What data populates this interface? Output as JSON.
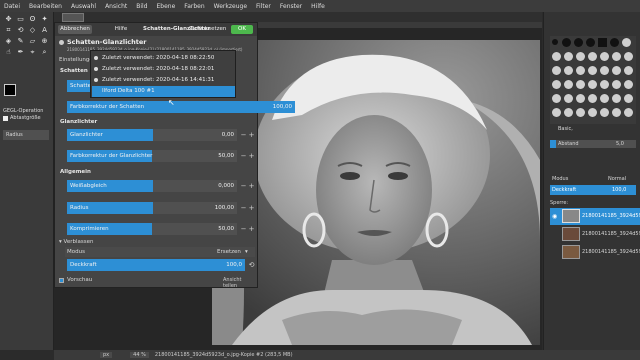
{
  "menubar": {
    "items": [
      "Datei",
      "Bearbeiten",
      "Auswahl",
      "Ansicht",
      "Bild",
      "Ebene",
      "Farben",
      "Werkzeuge",
      "Filter",
      "Fenster",
      "Hilfe"
    ]
  },
  "tool_options": {
    "title": "GEGL-Operation",
    "sample_merged": "Abtastgröße",
    "radius_label": "Radius"
  },
  "dialog": {
    "cancel": "Abbrechen",
    "help": "Hilfe",
    "title": "Schatten-Glanzlichter",
    "reset": "Zurücksetzen",
    "ok": "OK",
    "op_title": "Schatten-Glanzlichter",
    "image_ref": "21800141185_3924d5923d_o.jpg-Kopie-[2] (21800141185_3924d5923d_o) (importiert)",
    "presets_label": "Einstellungen",
    "section_shadows": "Schatten",
    "shadows_label": "Schatten",
    "shadows_color_label": "Farbkorrektur der Schatten",
    "shadows_color_value": "100,00",
    "section_highlights": "Glanzlichter",
    "highlights_label": "Glanzlichter",
    "highlights_value": "0,00",
    "highlights_color_label": "Farbkorrektur der Glanzlichter",
    "highlights_color_value": "50,00",
    "section_common": "Allgemein",
    "whitepoint_label": "Weißabgleich",
    "whitepoint_value": "0,000",
    "radius_label": "Radius",
    "radius_value": "100,00",
    "compress_label": "Komprimieren",
    "compress_value": "50,00",
    "blend_header": "Verblassen",
    "mode_label": "Modus",
    "mode_value": "Ersetzen",
    "opacity_label": "Deckkraft",
    "opacity_value": "100,0",
    "preview_label": "Vorschau",
    "split_view_label": "Ansicht teilen"
  },
  "dialog_levels": {
    "shadows_color": 1.0,
    "highlights": 0.0,
    "highlights_color": 0.5,
    "whitepoint": 0.0,
    "radius": 0.33,
    "compress": 0.5,
    "opacity": 1.0
  },
  "presets_popup": {
    "items": [
      "Zuletzt verwendet: 2020-04-18 08:22:50",
      "Zuletzt verwendet: 2020-04-18 08:22:01",
      "Zuletzt verwendet: 2020-04-16 14:41:31",
      "Ilford Delta 100 #1"
    ]
  },
  "right_dock": {
    "brush_name": "Basic,",
    "abstand_label": "Abstand",
    "abstand_value": "5,0",
    "mode_label": "Modus",
    "mode_value": "Normal",
    "opacity_label": "Deckkraft",
    "opacity_value": "100,0",
    "lock_label": "Sperre:",
    "layers": [
      "21800141185_3924d5923",
      "21800141185_3924d5923",
      "21800141185_3924d5923"
    ]
  },
  "statusbar": {
    "unit": "px",
    "zoom": "44 %",
    "file_info": "21800141185_3924d5923d_o.jpg-Kopie #2 (283,5 MB)"
  },
  "colors": {
    "accent": "#2d8fd5",
    "ok_green": "#4db84d",
    "dialog_bg": "#454545",
    "panel_bg": "#333333"
  }
}
